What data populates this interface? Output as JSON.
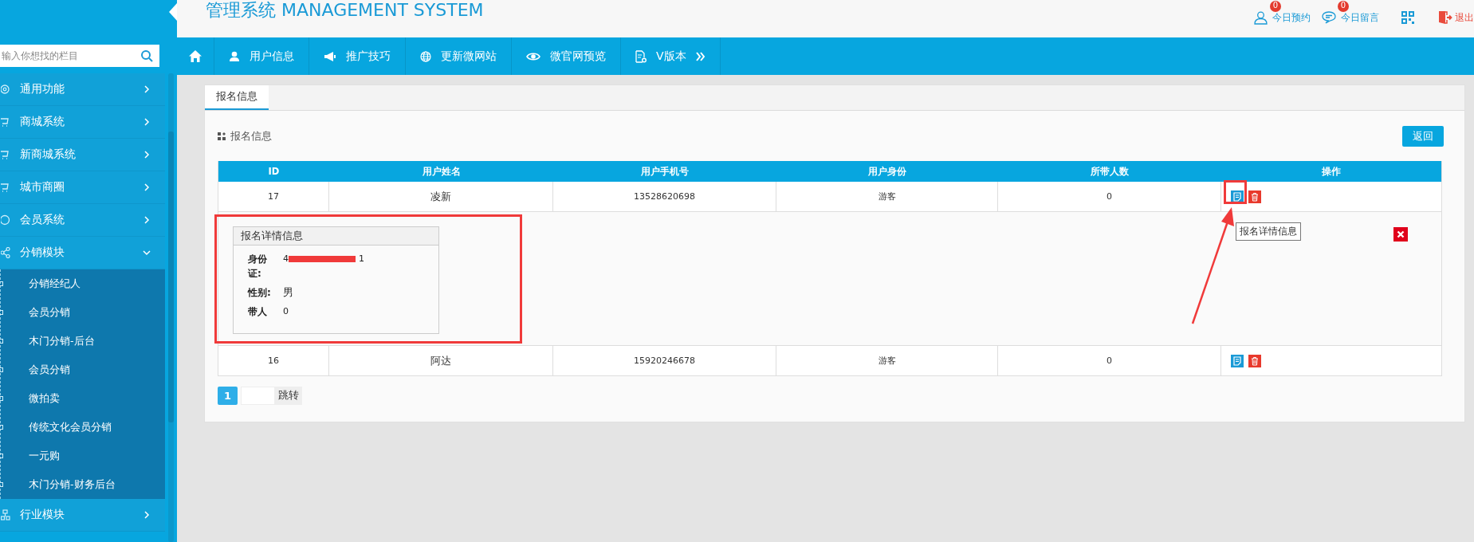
{
  "sidebar": {
    "search": {
      "placeholder": "输入你想找的栏目"
    },
    "items": [
      {
        "label": "通用功能",
        "kind": "gear",
        "expanded": false
      },
      {
        "label": "商城系统",
        "kind": "cart",
        "expanded": false
      },
      {
        "label": "新商城系统",
        "kind": "cart",
        "expanded": false
      },
      {
        "label": "城市商圈",
        "kind": "cart",
        "expanded": false
      },
      {
        "label": "会员系统",
        "kind": "vip",
        "expanded": false
      },
      {
        "label": "分销模块",
        "kind": "share",
        "expanded": true,
        "children": [
          {
            "label": "分销经纪人"
          },
          {
            "label": "会员分销"
          },
          {
            "label": "木门分销-后台"
          },
          {
            "label": "会员分销"
          },
          {
            "label": "微拍卖"
          },
          {
            "label": "传统文化会员分销"
          },
          {
            "label": "一元购"
          },
          {
            "label": "木门分销-财务后台"
          }
        ]
      },
      {
        "label": "行业模块",
        "kind": "network",
        "expanded": false
      }
    ]
  },
  "header": {
    "title": "管理系统 MANAGEMENT SYSTEM",
    "actions": [
      {
        "kind": "person",
        "label": "今日预约",
        "badge": "0"
      },
      {
        "kind": "chat",
        "label": "今日留言",
        "badge": "0"
      },
      {
        "kind": "qr"
      },
      {
        "kind": "exit",
        "label": "退出"
      }
    ]
  },
  "nav": {
    "items": [
      {
        "kind": "home"
      },
      {
        "kind": "user",
        "label": "用户信息"
      },
      {
        "kind": "megaphone",
        "label": "推广技巧"
      },
      {
        "kind": "globe",
        "label": "更新微网站"
      },
      {
        "kind": "eye",
        "label": "微官网预览"
      },
      {
        "kind": "doc",
        "label": "V版本",
        "more": true
      }
    ]
  },
  "panel": {
    "tabs": [
      {
        "label": "报名信息",
        "selected": true
      }
    ],
    "section_title": "报名信息",
    "back_button": "返回"
  },
  "table": {
    "columns": [
      "ID",
      "用户姓名",
      "用户手机号",
      "用户身份",
      "所带人数",
      "操作"
    ],
    "rows": [
      {
        "cells": [
          "17",
          "凌新",
          "13528620698",
          "游客",
          "0"
        ],
        "expanded": true
      },
      {
        "cells": [
          "16",
          "阿达",
          "15920246678",
          "游客",
          "0"
        ],
        "expanded": false
      }
    ]
  },
  "detail": {
    "title": "报名详情信息",
    "tooltip": "报名详情信息",
    "fields": [
      {
        "label": "身份证:",
        "value": "4",
        "redacted": true,
        "value_end": "1"
      },
      {
        "label": "性别:",
        "value": "男",
        "redacted": false
      },
      {
        "label": "带人",
        "value": "0",
        "redacted": false
      }
    ]
  },
  "pagination": {
    "pages": [
      {
        "label": "1",
        "selected": true
      }
    ],
    "jump_button": "跳转"
  }
}
